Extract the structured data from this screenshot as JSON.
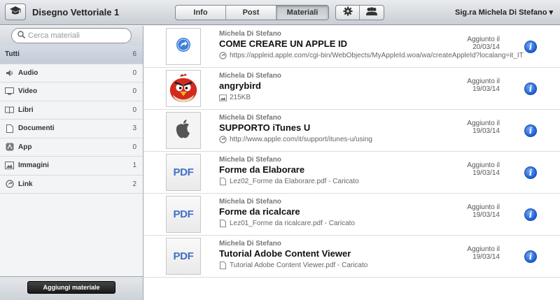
{
  "header": {
    "app_title": "Disegno Vettoriale 1",
    "tabs": [
      {
        "label": "Info",
        "active": false
      },
      {
        "label": "Post",
        "active": false
      },
      {
        "label": "Materiali",
        "active": true
      }
    ],
    "user_label": "Sig.ra Michela Di Stefano ▾"
  },
  "sidebar": {
    "search_placeholder": "Cerca materiali",
    "categories": [
      {
        "label": "Tutti",
        "count": "6",
        "icon": "none",
        "active": true
      },
      {
        "label": "Audio",
        "count": "0",
        "icon": "speaker-icon"
      },
      {
        "label": "Video",
        "count": "0",
        "icon": "monitor-icon"
      },
      {
        "label": "Libri",
        "count": "0",
        "icon": "book-icon"
      },
      {
        "label": "Documenti",
        "count": "3",
        "icon": "document-icon"
      },
      {
        "label": "App",
        "count": "0",
        "icon": "app-icon"
      },
      {
        "label": "Immagini",
        "count": "1",
        "icon": "image-icon"
      },
      {
        "label": "Link",
        "count": "2",
        "icon": "link-icon"
      }
    ],
    "add_button": "Aggiungi materiale"
  },
  "materials": [
    {
      "author": "Michela Di Stefano",
      "title": "COME CREARE UN APPLE ID",
      "subtitle": "https://appleid.apple.com/cgi-bin/WebObjects/MyAppleId.woa/wa/createAppleId?localang=it_IT",
      "sub_icon": "link-icon",
      "thumb": "link-thumb",
      "added_label": "Aggiunto il",
      "added_date": "20/03/14"
    },
    {
      "author": "Michela Di Stefano",
      "title": "angrybird",
      "subtitle": "215KB",
      "sub_icon": "image-icon",
      "thumb": "angrybird-image",
      "added_label": "Aggiunto il",
      "added_date": "19/03/14"
    },
    {
      "author": "Michela Di Stefano",
      "title": "SUPPORTO iTunes U",
      "subtitle": "http://www.apple.com/it/support/itunes-u/using",
      "sub_icon": "link-icon",
      "thumb": "apple-logo",
      "added_label": "Aggiunto il",
      "added_date": "19/03/14"
    },
    {
      "author": "Michela Di Stefano",
      "title": "Forme da Elaborare",
      "subtitle": "Lez02_Forme da Elaborare.pdf - Caricato",
      "sub_icon": "document-icon",
      "thumb": "pdf",
      "thumb_text": "PDF",
      "added_label": "Aggiunto il",
      "added_date": "19/03/14"
    },
    {
      "author": "Michela Di Stefano",
      "title": "Forme da ricalcare",
      "subtitle": "Lez01_Forme da ricalcare.pdf - Caricato",
      "sub_icon": "document-icon",
      "thumb": "pdf",
      "thumb_text": "PDF",
      "added_label": "Aggiunto il",
      "added_date": "19/03/14"
    },
    {
      "author": "Michela Di Stefano",
      "title": "Tutorial Adobe Content Viewer",
      "subtitle": "Tutorial Adobe Content Viewer.pdf - Caricato",
      "sub_icon": "document-icon",
      "thumb": "pdf",
      "thumb_text": "PDF",
      "added_label": "Aggiunto il",
      "added_date": "19/03/14"
    }
  ],
  "colors": {
    "accent": "#1d5fd6",
    "pdf_text": "#3f6fc6",
    "angrybird_red": "#d32a1e"
  }
}
